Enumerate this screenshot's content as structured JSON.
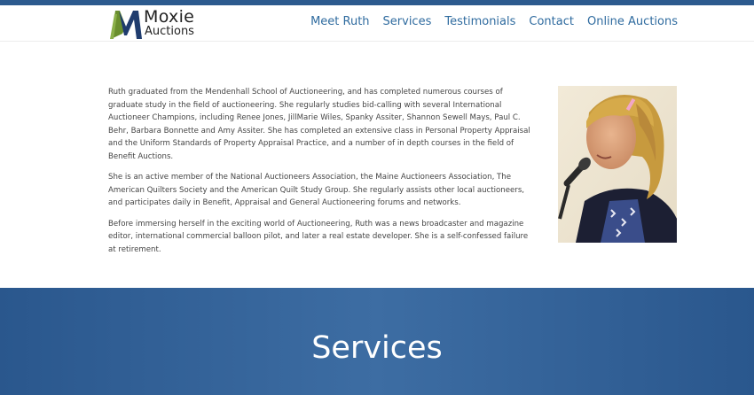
{
  "brand": {
    "line1": "Moxie",
    "line2": "Auctions",
    "colors": {
      "green": "#6a8f2e",
      "navy": "#1f3c6e"
    }
  },
  "nav": {
    "items": [
      "Meet Ruth",
      "Services",
      "Testimonials",
      "Contact",
      "Online Auctions"
    ]
  },
  "bio": {
    "paragraphs": [
      "Ruth graduated from the Mendenhall School of Auctioneering, and has completed numerous courses of graduate study in the field of auctioneering. She regularly studies bid-calling with several International Auctioneer Champions, including Renee Jones, JillMarie Wiles, Spanky Assiter, Shannon Sewell Mays, Paul C. Behr, Barbara Bonnette and Amy Assiter. She has completed an extensive class in Personal Property Appraisal and the Uniform Standards of Property Appraisal Practice, and a number of in depth courses in the field of Benefit Auctions.",
      "She is an active member of the National Auctioneers Association, the Maine Auctioneers Association, The American Quilters Society and the American Quilt Study Group. She regularly assists other local auctioneers, and participates daily in Benefit, Appraisal and General Auctioneering forums and networks.",
      "Before immersing herself in the exciting world of Auctioneering, Ruth was a news broadcaster and magazine editor, international commercial balloon pilot, and later a real estate developer. She is a self-confessed failure at retirement."
    ]
  },
  "services": {
    "title": "Services",
    "band_color": "#2f5e95"
  },
  "colors": {
    "topbar": "#2c5a8e",
    "nav_link": "#2f6b9f",
    "body_text": "#444444"
  }
}
